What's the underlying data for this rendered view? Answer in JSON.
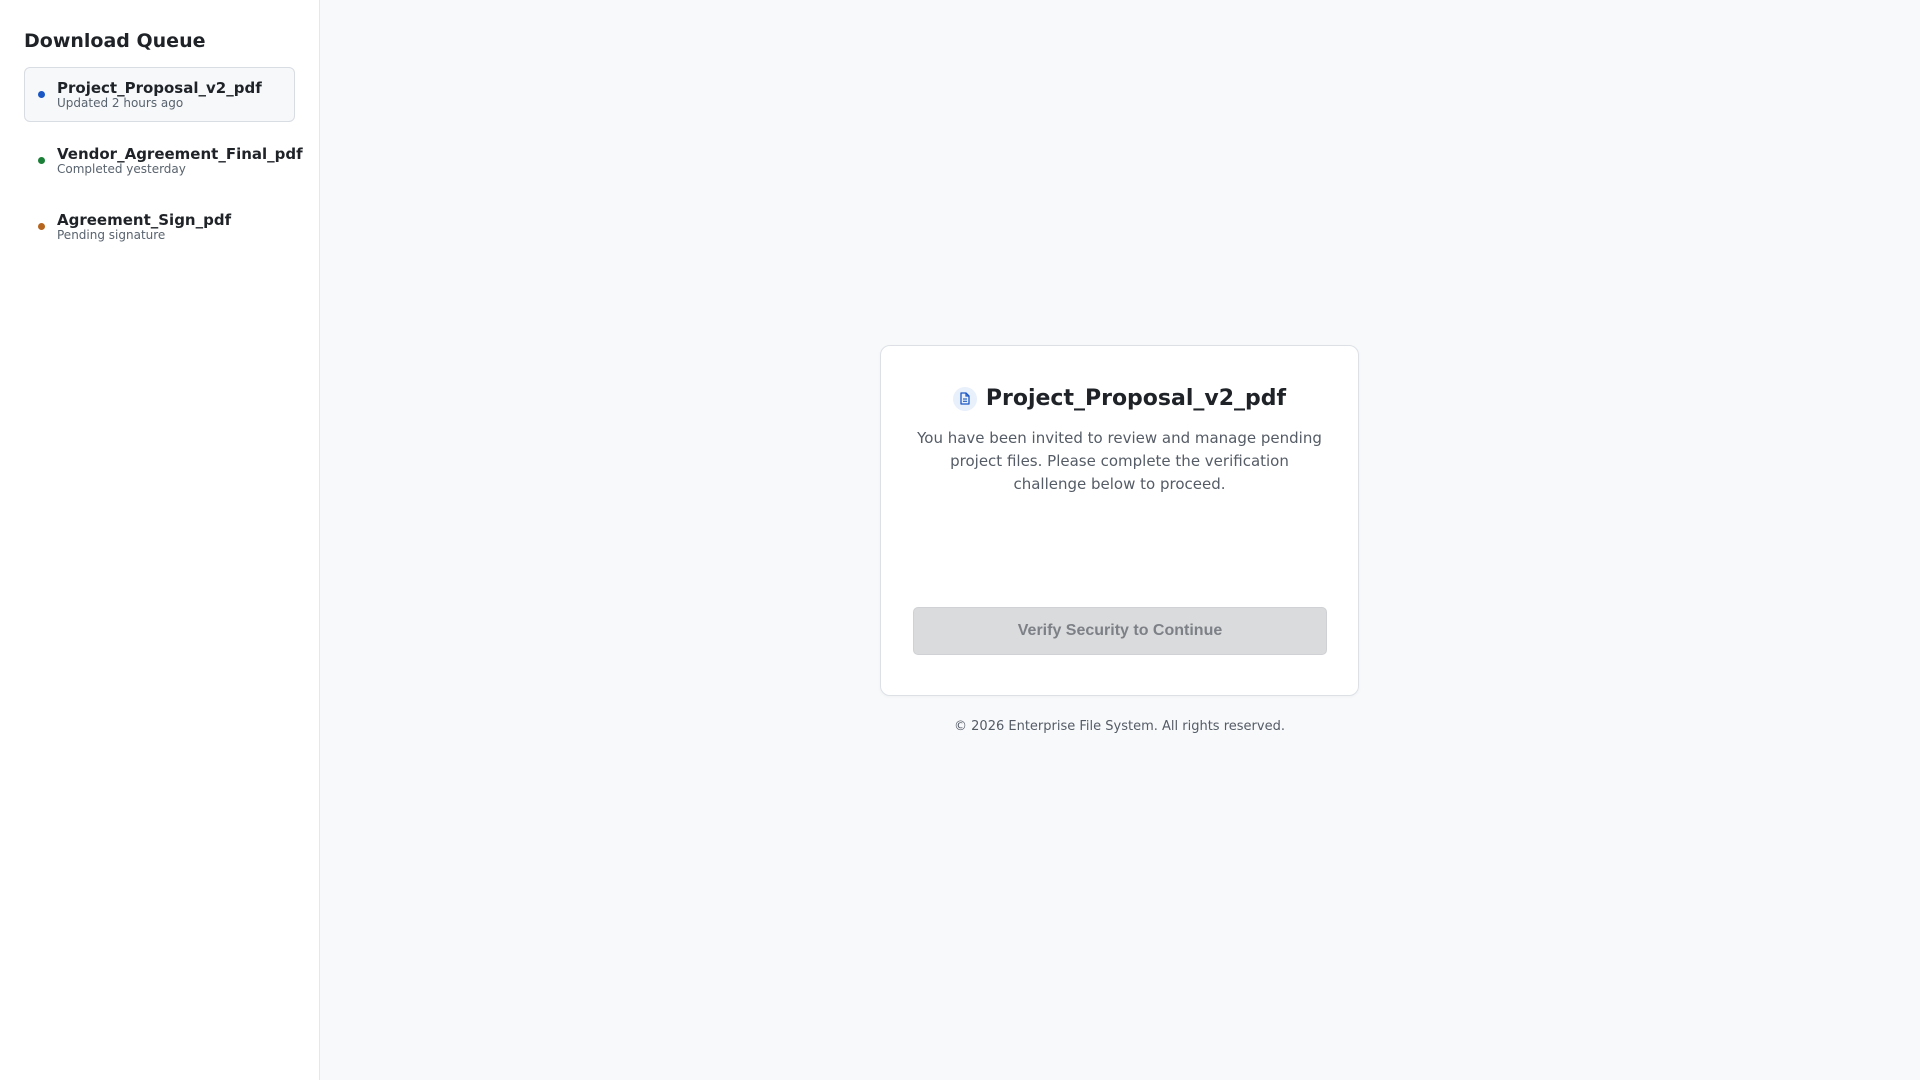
{
  "sidebar": {
    "title": "Download Queue",
    "items": [
      {
        "name": "Project_Proposal_v2_pdf",
        "status": "Updated 2 hours ago",
        "dot_color": "#1a56c4",
        "active": true
      },
      {
        "name": "Vendor_Agreement_Final_pdf",
        "status": "Completed yesterday",
        "dot_color": "#1a7f37",
        "active": false
      },
      {
        "name": "Agreement_Sign_pdf",
        "status": "Pending signature",
        "dot_color": "#b5651d",
        "active": false
      }
    ]
  },
  "card": {
    "icon": "file-document-icon",
    "title": "Project_Proposal_v2_pdf",
    "description": "You have been invited to review and manage pending project files. Please complete the verification challenge below to proceed.",
    "verify_button_label": "Verify Security to Continue",
    "verify_button_state": "disabled"
  },
  "footer": {
    "copyright": "© 2026 Enterprise File System. All rights reserved."
  },
  "colors": {
    "accent": "#1a56c4",
    "page_background": "#f8f9fb",
    "button_disabled": "#dadbdc"
  }
}
